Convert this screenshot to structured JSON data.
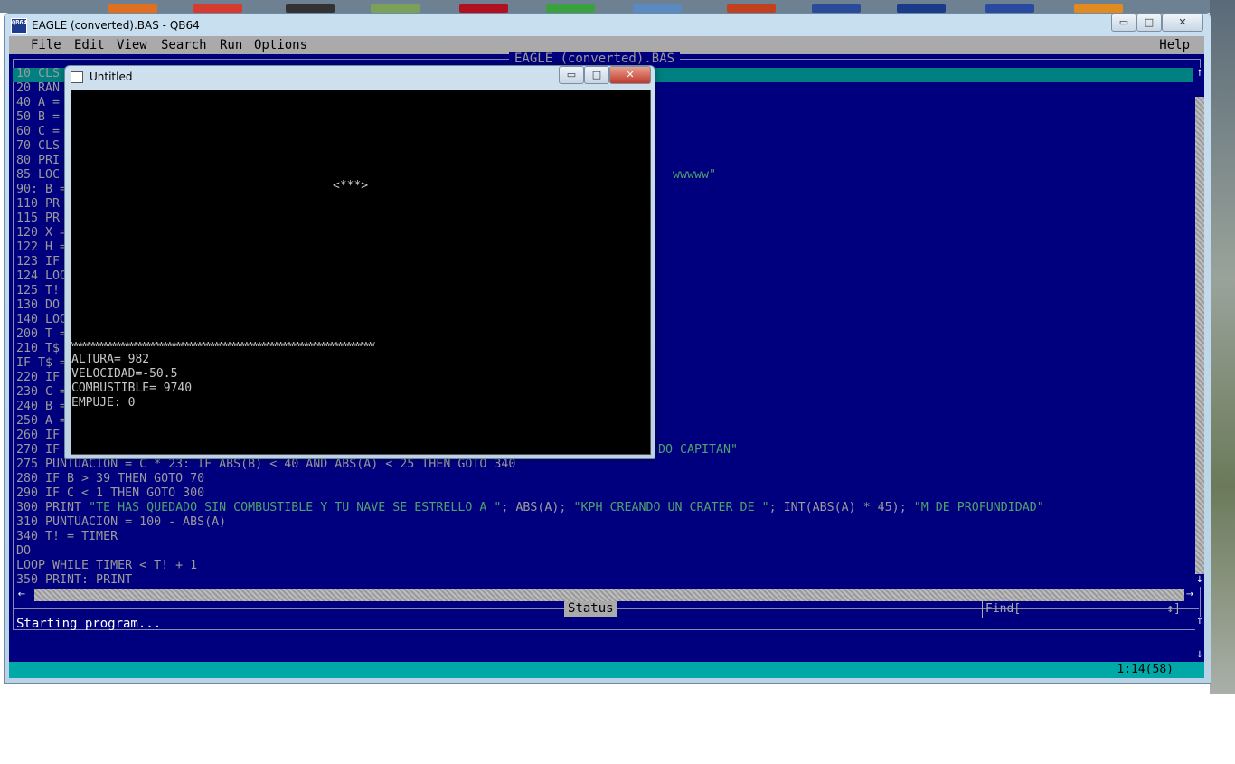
{
  "window": {
    "title": "EAGLE (converted).BAS - QB64",
    "app_icon_text": "QB64",
    "minimize_glyph": "▭",
    "maximize_glyph": "□",
    "close_glyph": "✕"
  },
  "menu": {
    "items": [
      "File",
      "Edit",
      "View",
      "Search",
      "Run",
      "Options"
    ],
    "help": "Help"
  },
  "editor": {
    "file_title": "EAGLE (converted).BAS",
    "lines": [
      {
        "text": "10 CLS"
      },
      {
        "text": "20 RAN"
      },
      {
        "text": "40 A ="
      },
      {
        "text": "50 B ="
      },
      {
        "text": "60 C ="
      },
      {
        "text": "70 CLS"
      },
      {
        "text": "80 PRI"
      },
      {
        "text": "85 LOC",
        "tail": "wwwww\""
      },
      {
        "text": "90: B ="
      },
      {
        "text": "110 PR"
      },
      {
        "text": "115 PR"
      },
      {
        "text": "120 X ="
      },
      {
        "text": "122 H ="
      },
      {
        "text": "123 IF"
      },
      {
        "text": "124 LOO"
      },
      {
        "text": "125 T!"
      },
      {
        "text": "130 DO"
      },
      {
        "text": "140 LOO"
      },
      {
        "text": "200 T ="
      },
      {
        "text": "210 T$"
      },
      {
        "text": "IF T$ ="
      },
      {
        "text": "220 IF"
      },
      {
        "text": "230 C ="
      },
      {
        "text": "240 B ="
      },
      {
        "text": "250 A ="
      },
      {
        "text": "260 IF"
      },
      {
        "text": "270 IF",
        "tail": "DO CAPITAN\""
      },
      {
        "text": "275 PUNTUACION = C * 23: IF ABS(B) < 40 AND ABS(A) < 25 THEN GOTO 340"
      },
      {
        "text": "280 IF B > 39 THEN GOTO 70"
      },
      {
        "text": "290 IF C < 1 THEN GOTO 300"
      },
      {
        "text": "300 PRINT \"TE HAS QUEDADO SIN COMBUSTIBLE Y TU NAVE SE ESTRELLO A \"; ABS(A); \"KPH CREANDO UN CRATER DE \"; INT(ABS(A) * 45); \"M DE PROFUNDIDAD\""
      },
      {
        "text": "310 PUNTUACION = 100 - ABS(A)"
      },
      {
        "text": "340 T! = TIMER"
      },
      {
        "text": "DO"
      },
      {
        "text": "LOOP WHILE TIMER < T! + 1"
      },
      {
        "text": "350 PRINT: PRINT"
      }
    ]
  },
  "status": {
    "label": "Status",
    "find_label": "Find[",
    "find_arrows": "↕]",
    "message": "Starting program...",
    "cursor_position": "1:14(58)"
  },
  "scroll": {
    "up": "↑",
    "down": "↓",
    "left": "←",
    "right": "→"
  },
  "run_window": {
    "title": "Untitled",
    "ship": "<***>",
    "ground": "wwwwwwwwwwwwwwwwwwwwwwwwwwwwwwwwwwwwwwwwwwwwwwwwwwwwwwwwwwwwwwwwwwwwwww",
    "altura": "ALTURA= 982",
    "velocidad": "VELOCIDAD=-50.5",
    "combustible": "COMBUSTIBLE= 9740",
    "empuje": "EMPUJE: 0"
  },
  "colors": {
    "ide_background": "#00007f",
    "code_text": "#9a9a9a",
    "string_text": "#4fa070",
    "current_line": "#008080",
    "bottom_bar": "#00a8a8",
    "menubar": "#aaaaaa"
  }
}
